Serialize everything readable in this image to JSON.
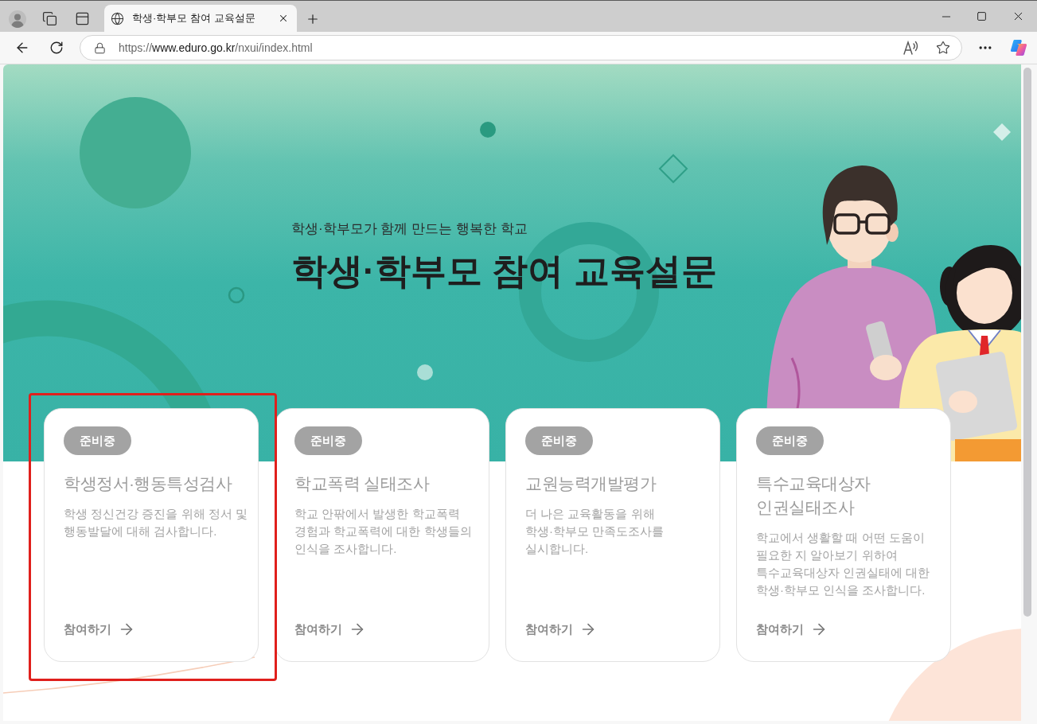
{
  "browser": {
    "tab": {
      "title": "학생·학부모 참여 교육설문",
      "selected": true
    },
    "address_bar": {
      "scheme": "https://",
      "host": "www.eduro.go.kr",
      "path": "/nxui/index.html"
    }
  },
  "hero": {
    "subtitle": "학생·학부모가 함께 만드는 행복한 학교",
    "title": "학생·학부모 참여 교육설문"
  },
  "cards": [
    {
      "badge": "준비중",
      "title": "학생정서·행동특성검사",
      "description_lines": [
        "학생 정신건강 증진을 위해 정서 및",
        "행동발달에 대해 검사합니다."
      ],
      "link": "참여하기",
      "highlighted": true
    },
    {
      "badge": "준비중",
      "title": "학교폭력 실태조사",
      "description_lines": [
        "학교 안팎에서 발생한 학교폭력",
        "경험과 학교폭력에 대한 학생들의",
        "인식을 조사합니다."
      ],
      "link": "참여하기",
      "highlighted": false
    },
    {
      "badge": "준비중",
      "title": "교원능력개발평가",
      "description_lines": [
        "더 나은 교육활동을 위해",
        "학생·학부모 만족도조사를",
        "실시합니다."
      ],
      "link": "참여하기",
      "highlighted": false
    },
    {
      "badge": "준비중",
      "title": "특수교육대상자 인권실태조사",
      "description_lines": [
        "학교에서 생활할 때 어떤 도움이",
        "필요한 지 알아보기 위하여",
        "특수교육대상자 인권실태에 대한",
        "학생·학부모 인식을 조사합니다."
      ],
      "link": "참여하기",
      "highlighted": false
    }
  ]
}
